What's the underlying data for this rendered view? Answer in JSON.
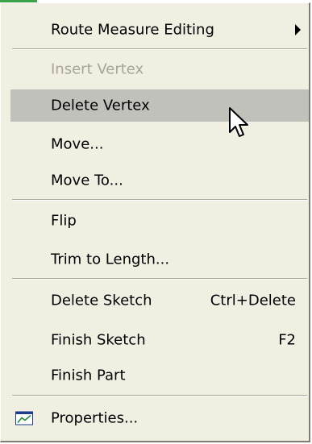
{
  "context_menu": {
    "items": [
      {
        "label": "Route Measure Editing",
        "shortcut": "",
        "state": "normal"
      },
      {
        "label": "Insert Vertex",
        "shortcut": "",
        "state": "disabled"
      },
      {
        "label": "Delete Vertex",
        "shortcut": "",
        "state": "highlighted"
      },
      {
        "label": "Move...",
        "shortcut": "",
        "state": "normal"
      },
      {
        "label": "Move To...",
        "shortcut": "",
        "state": "normal"
      },
      {
        "label": "Flip",
        "shortcut": "",
        "state": "normal"
      },
      {
        "label": "Trim to Length...",
        "shortcut": "",
        "state": "normal"
      },
      {
        "label": "Delete Sketch",
        "shortcut": "Ctrl+Delete",
        "state": "normal"
      },
      {
        "label": "Finish Sketch",
        "shortcut": "F2",
        "state": "normal"
      },
      {
        "label": "Finish Part",
        "shortcut": "",
        "state": "normal"
      },
      {
        "label": "Properties...",
        "shortcut": "",
        "state": "normal",
        "icon": "properties-chart-icon"
      }
    ],
    "submenu_icon": "triangle-right-icon",
    "cursor_icon": "mouse-pointer-icon"
  },
  "colors": {
    "menu_background": "#f1efe2",
    "highlight": "#c1c1bb",
    "disabled_text": "#a8a596",
    "separator": "#aca899"
  }
}
